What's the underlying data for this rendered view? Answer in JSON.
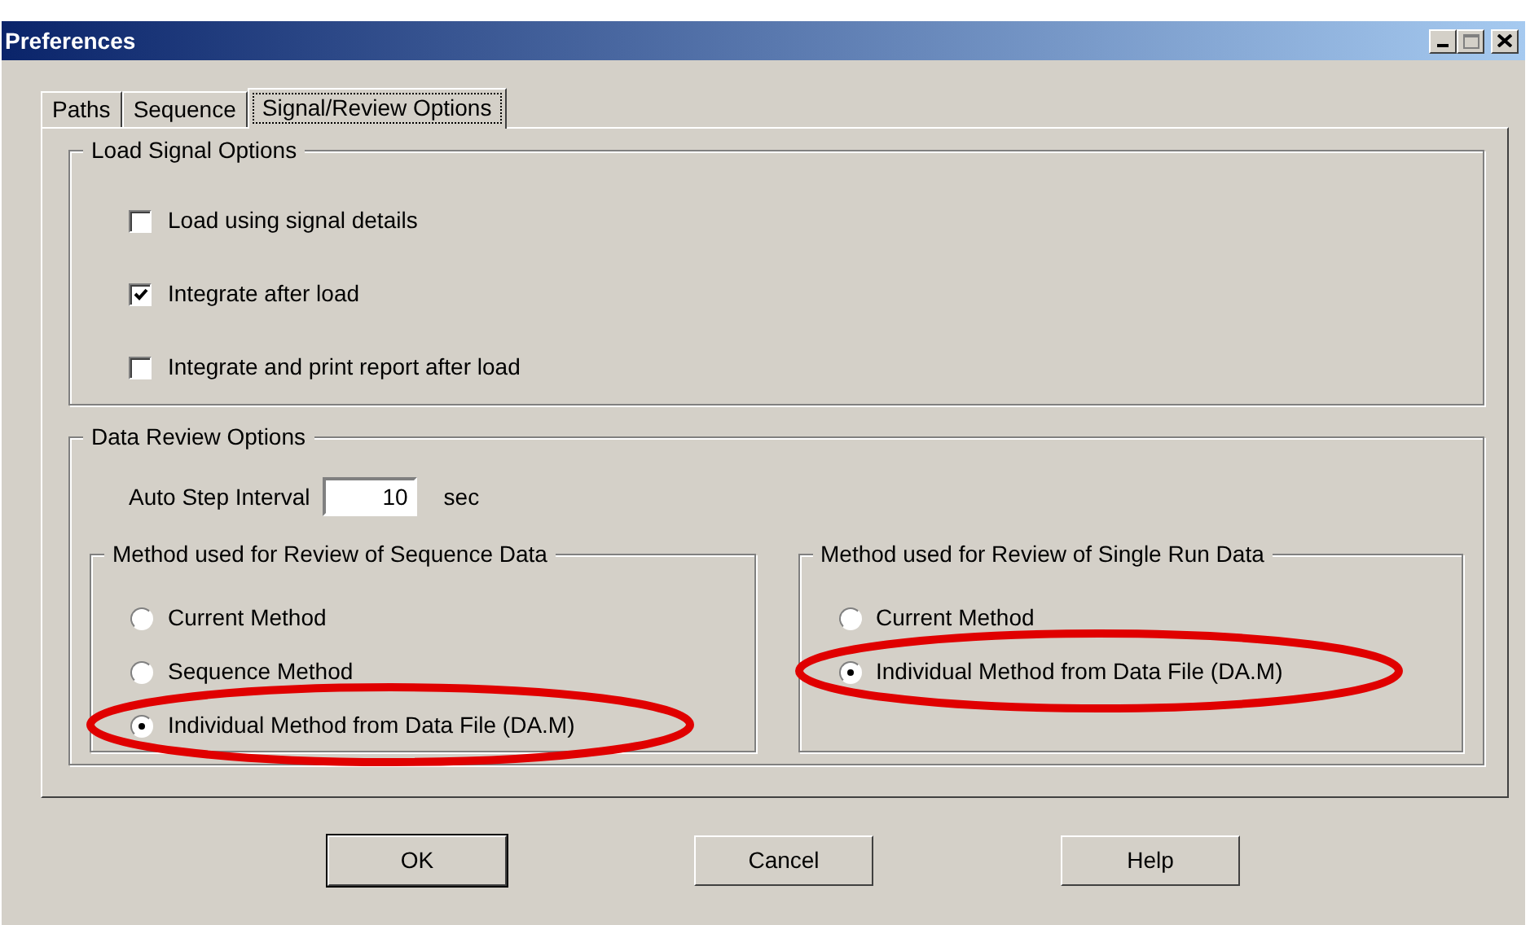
{
  "window": {
    "title": "Preferences"
  },
  "tabs": [
    {
      "label": "Paths",
      "selected": false
    },
    {
      "label": "Sequence",
      "selected": false
    },
    {
      "label": "Signal/Review Options",
      "selected": true
    }
  ],
  "load_signal_options": {
    "title": "Load Signal Options",
    "options": [
      {
        "label": "Load using signal details",
        "checked": false
      },
      {
        "label": "Integrate after load",
        "checked": true
      },
      {
        "label": "Integrate and print report after load",
        "checked": false
      }
    ]
  },
  "data_review_options": {
    "title": "Data Review Options",
    "auto_step_interval": {
      "label": "Auto Step Interval",
      "value": "10",
      "unit": "sec"
    },
    "groups": [
      {
        "title": "Method used for Review of Sequence Data",
        "options": [
          {
            "label": "Current Method",
            "selected": false,
            "circled": false
          },
          {
            "label": "Sequence Method",
            "selected": false,
            "circled": false
          },
          {
            "label": "Individual Method from Data File (DA.M)",
            "selected": true,
            "circled": true
          }
        ]
      },
      {
        "title": "Method used for Review of Single Run Data",
        "options": [
          {
            "label": "Current Method",
            "selected": false,
            "circled": false
          },
          {
            "label": "Individual Method from Data File (DA.M)",
            "selected": true,
            "circled": true
          }
        ]
      }
    ]
  },
  "buttons": [
    "OK",
    "Cancel",
    "Help"
  ]
}
